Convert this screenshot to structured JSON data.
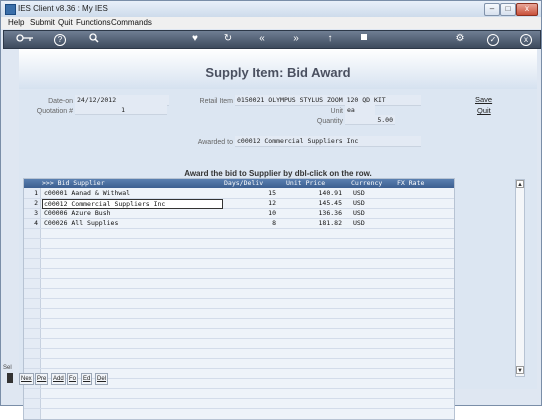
{
  "window": {
    "title": "IES Client v8.36 : My IES"
  },
  "menu": [
    "Help",
    "Submit",
    "Quit",
    "Functions",
    "Commands"
  ],
  "toolbar_icons": [
    "back-key-icon",
    "help-icon",
    "search-icon",
    "heart-icon",
    "refresh-icon",
    "rewind-icon",
    "forward-icon",
    "up-icon",
    "stop-icon",
    "settings-icon",
    "check-icon",
    "close-icon"
  ],
  "toolbar_glyphs": {
    "help": "?",
    "check": "✓",
    "close": "x"
  },
  "form": {
    "title": "Supply Item: Bid Award",
    "date_on_label": "Date-on",
    "date_on_value": "24/12/2012",
    "quotation_label": "Quotation #",
    "quotation_value": "1",
    "retail_item_label": "Retail Item",
    "retail_item_value": "0150021 OLYMPUS STYLUS ZOOM 120 QD KIT",
    "unit_label": "Unit",
    "unit_value": "ea",
    "quantity_label": "Quantity",
    "quantity_value": "5.00",
    "awarded_to_label": "Awarded to",
    "awarded_to_value": "c00012 Commercial Suppliers Inc",
    "save_label": "Save",
    "quit_label": "Quit",
    "instruction": "Award the bid to Supplier by dbl-click on the row."
  },
  "table": {
    "headers": [
      ">>> Bid Supplier",
      "Days/Deliv",
      "Unit Price",
      "Currency",
      "FX Rate"
    ],
    "rows": [
      {
        "num": "1",
        "supplier": "c00001 Aanad & Withwal",
        "days": "15",
        "price": "140.91",
        "currency": "USD"
      },
      {
        "num": "2",
        "supplier": "c00012 Commercial Suppliers Inc",
        "days": "12",
        "price": "145.45",
        "currency": "USD"
      },
      {
        "num": "3",
        "supplier": "C00006 Azure Bush",
        "days": "10",
        "price": "136.36",
        "currency": "USD"
      },
      {
        "num": "4",
        "supplier": "C00026 All Supplies",
        "days": "8",
        "price": "181.82",
        "currency": "USD"
      }
    ]
  },
  "bottom_buttons": [
    "Nex",
    "Pre",
    "Add",
    "Fo",
    "Ed",
    "Del"
  ],
  "left_panel": {
    "sel_label": "Sel"
  }
}
